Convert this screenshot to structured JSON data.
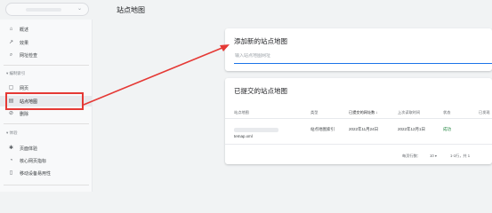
{
  "header": {
    "page_title": "站点地图",
    "property_chevron": "⌄"
  },
  "sidebar": {
    "items": [
      {
        "icon": "⌂",
        "label": "概述"
      },
      {
        "icon": "↗",
        "label": "效果"
      },
      {
        "icon": "⌕",
        "label": "网址检查"
      }
    ],
    "index_section": "▾ 编制索引",
    "index_items": [
      {
        "icon": "▢",
        "label": "网页"
      },
      {
        "icon": "▤",
        "label": "站点地图"
      },
      {
        "icon": "⊘",
        "label": "删除"
      }
    ],
    "experience_section": "▾ 体验",
    "experience_items": [
      {
        "icon": "✱",
        "label": "页面体验"
      },
      {
        "icon": "◔",
        "label": "核心网页指标"
      },
      {
        "icon": "▯",
        "label": "移动设备易用性"
      }
    ]
  },
  "add_card": {
    "title": "添加新的站点地图",
    "input_placeholder": "输入站点地图网址"
  },
  "submitted_card": {
    "title": "已提交的站点地图",
    "columns": [
      "站点地图",
      "类型",
      "已提交的网址数",
      "上次读取时间",
      "状态",
      "已发现"
    ],
    "sort_arrow": "↓",
    "row": {
      "url_suffix": "temap.xml",
      "type": "站点地图索引",
      "submitted": "2022年11月24日",
      "last_read": "2022年12月1日",
      "status": "成功"
    },
    "pagination": {
      "rows_per_page_label": "每页行数：",
      "rows_per_page": "10",
      "range": "1-1行，共 1"
    }
  },
  "colors": {
    "highlight": "#e53935",
    "accent": "#1a73e8",
    "success": "#188038"
  }
}
